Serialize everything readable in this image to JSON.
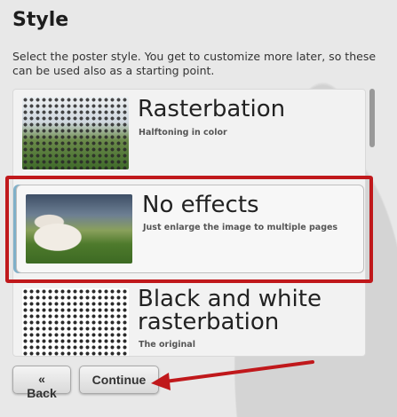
{
  "page": {
    "title": "Style",
    "description": "Select the poster style. You get to customize more later, so these can be used also as a starting point."
  },
  "options": [
    {
      "name": "Rasterbation",
      "subtitle": "Halftoning in color",
      "thumb": "halftone-color-thumbnail"
    },
    {
      "name": "No effects",
      "subtitle": "Just enlarge the image to multiple pages",
      "thumb": "cow-photo-thumbnail",
      "selected": true
    },
    {
      "name": "Black and white rasterbation",
      "name_line1": "Black and white",
      "name_line2": "rasterbation",
      "subtitle": "The original",
      "thumb": "halftone-bw-thumbnail"
    }
  ],
  "buttons": {
    "back": "« Back",
    "continue": "Continue"
  },
  "annotation": {
    "highlight_color": "#c0181b",
    "arrow_color": "#c0181b"
  }
}
